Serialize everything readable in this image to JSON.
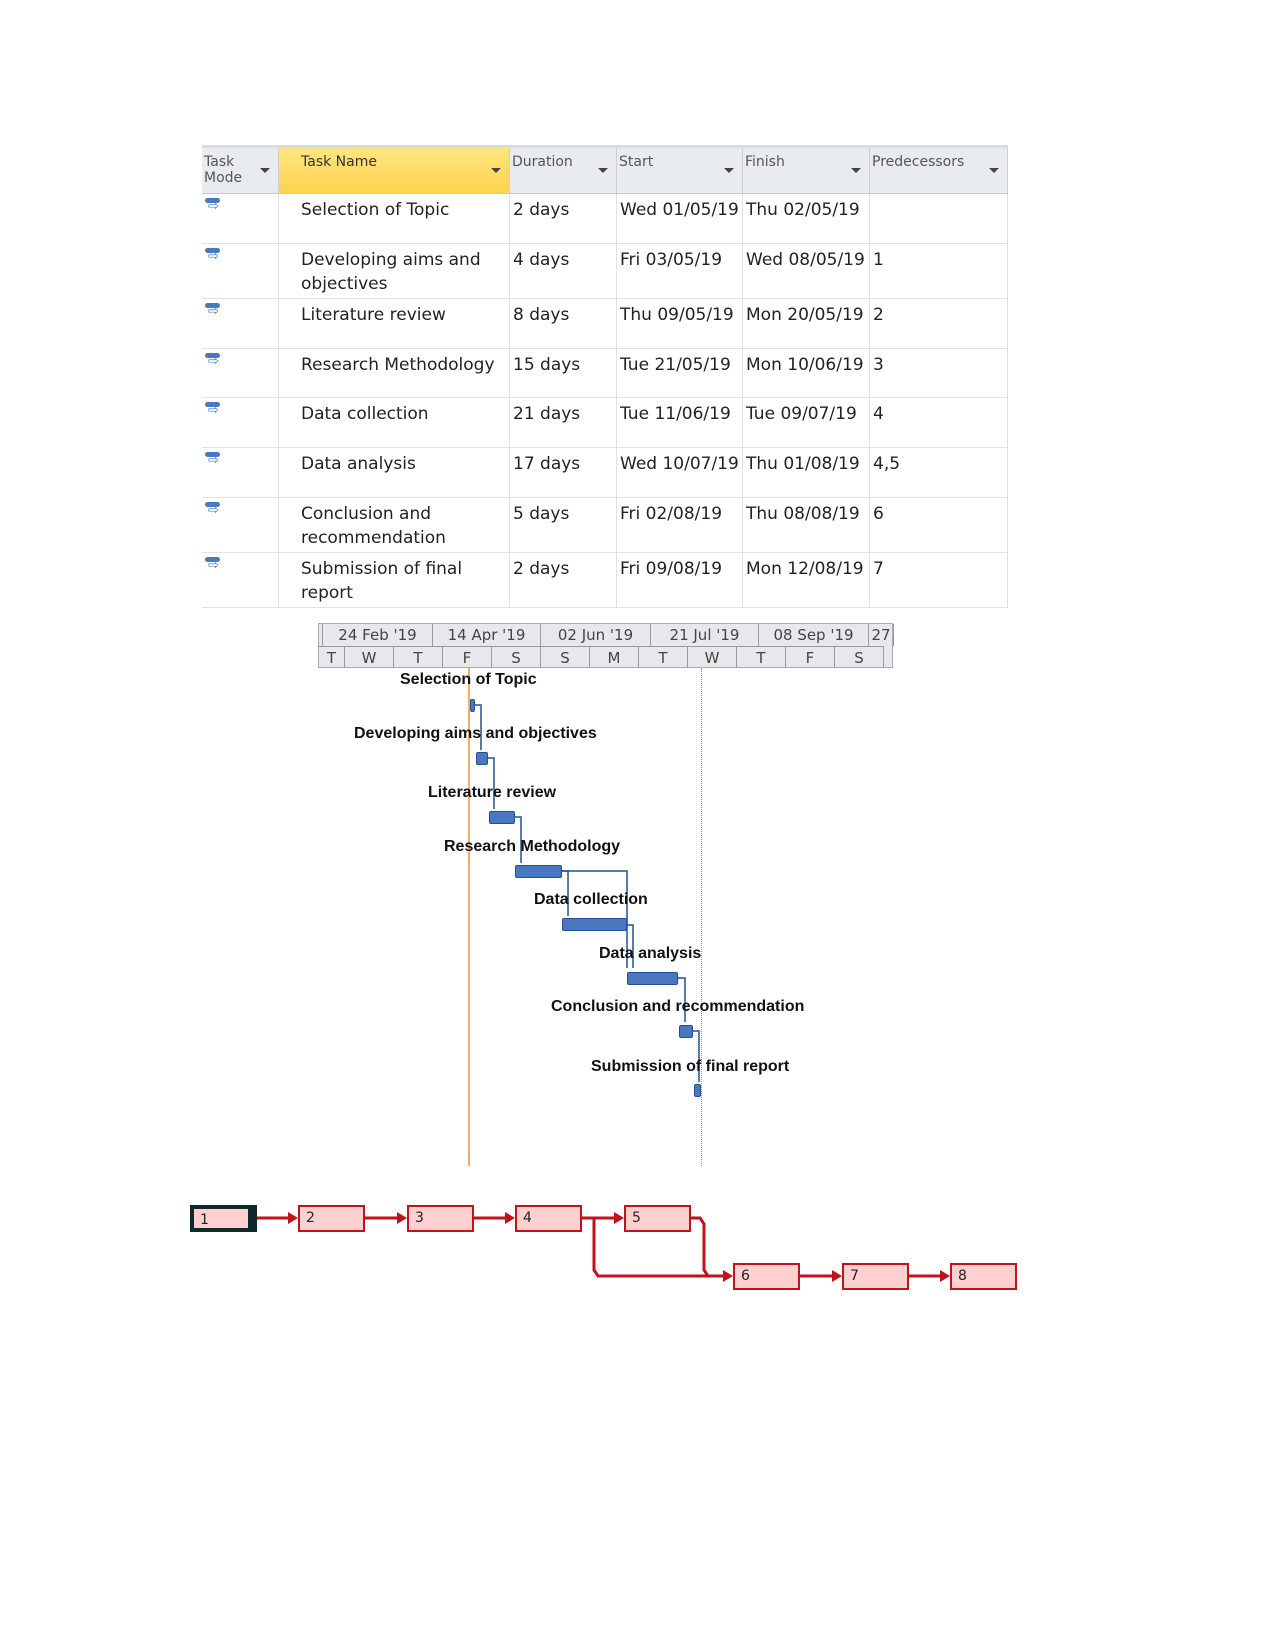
{
  "table": {
    "headers": [
      "Task Mode",
      "Task Name",
      "Duration",
      "Start",
      "Finish",
      "Predecessors"
    ],
    "rows": [
      {
        "name": "Selection of Topic",
        "duration": "2 days",
        "start": "Wed 01/05/19",
        "finish": "Thu 02/05/19",
        "pred": ""
      },
      {
        "name": "Developing aims and objectives",
        "duration": "4 days",
        "start": "Fri 03/05/19",
        "finish": "Wed 08/05/19",
        "pred": "1"
      },
      {
        "name": "Literature review",
        "duration": "8 days",
        "start": "Thu 09/05/19",
        "finish": "Mon 20/05/19",
        "pred": "2"
      },
      {
        "name": "Research Methodology",
        "duration": "15 days",
        "start": "Tue 21/05/19",
        "finish": "Mon 10/06/19",
        "pred": "3"
      },
      {
        "name": "Data collection",
        "duration": "21 days",
        "start": "Tue 11/06/19",
        "finish": "Tue 09/07/19",
        "pred": "4"
      },
      {
        "name": "Data analysis",
        "duration": "17 days",
        "start": "Wed 10/07/19",
        "finish": "Thu 01/08/19",
        "pred": "4,5"
      },
      {
        "name": "Conclusion and recommendation",
        "duration": "5 days",
        "start": "Fri 02/08/19",
        "finish": "Thu 08/08/19",
        "pred": "6"
      },
      {
        "name": "Submission of final report",
        "duration": "2 days",
        "start": "Fri 09/08/19",
        "finish": "Mon 12/08/19",
        "pred": "7"
      }
    ]
  },
  "gantt": {
    "timescale_top": [
      "24 Feb '19",
      "14 Apr '19",
      "02 Jun '19",
      "21 Jul '19",
      "08 Sep '19",
      "27"
    ],
    "timescale_bottom": [
      "T",
      "W",
      "T",
      "F",
      "S",
      "S",
      "M",
      "T",
      "W",
      "T",
      "F",
      "S"
    ],
    "labels": [
      "Selection of Topic",
      "Developing aims and objectives",
      "Literature review",
      "Research Methodology",
      "Data collection",
      "Data analysis",
      "Conclusion and recommendation",
      "Submission of final report"
    ],
    "bar_color": "#4a78c0"
  },
  "network": {
    "nodes": [
      "1",
      "2",
      "3",
      "4",
      "5",
      "6",
      "7",
      "8"
    ],
    "color": "#c0131b"
  }
}
